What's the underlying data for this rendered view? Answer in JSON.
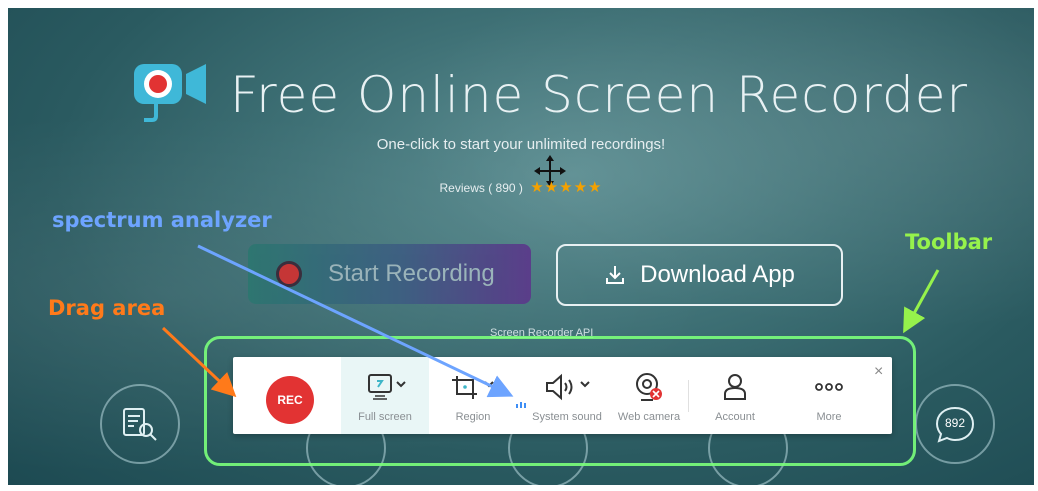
{
  "header": {
    "title": "Free Online Screen Recorder",
    "subtitle": "One-click to start your unlimited recordings!",
    "reviews_label": "Reviews ( 890 )",
    "stars": "★★★★★"
  },
  "buttons": {
    "start_recording": "Start Recording",
    "download_app": "Download App"
  },
  "api_link": "Screen Recorder API",
  "side_badge": "892",
  "toolbar": {
    "rec_label": "REC",
    "tools": [
      {
        "label": "Full screen",
        "icon": "monitor-icon"
      },
      {
        "label": "Region",
        "icon": "crop-icon"
      },
      {
        "label": "System sound",
        "icon": "speaker-icon"
      },
      {
        "label": "Web camera",
        "icon": "webcam-icon"
      },
      {
        "label": "Account",
        "icon": "user-icon"
      },
      {
        "label": "More",
        "icon": "more-icon"
      }
    ],
    "close": "×"
  },
  "annotations": {
    "spectrum": "spectrum analyzer",
    "toolbar": "Toolbar",
    "drag": "Drag area"
  },
  "colors": {
    "rec_red": "#e23333",
    "annot_blue": "#6da4ff",
    "annot_green": "#96f24c",
    "annot_orange": "#ff7a1a",
    "star": "#f4a100"
  }
}
